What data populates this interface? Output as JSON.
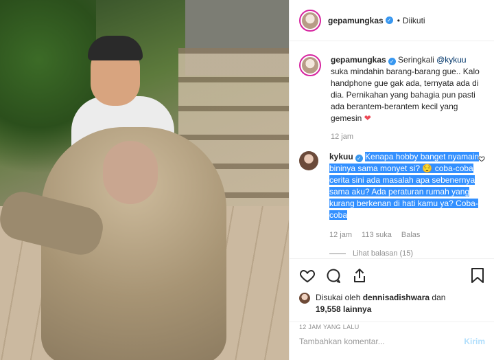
{
  "header": {
    "username": "gepamungkas",
    "separator": "•",
    "follow_status": "Diikuti"
  },
  "caption": {
    "username": "gepamungkas",
    "lead": "Seringkali ",
    "mention": "@kykuu",
    "text": " suka mindahin barang-barang gue.. Kalo handphone gue gak ada, ternyata ada di dia. Pernikahan yang bahagia pun pasti ada berantem-berantem kecil yang gemesin ",
    "heart": "❤",
    "time": "12 jam"
  },
  "reply": {
    "username": "kykuu",
    "text_1": "Kenapa hobby banget nyamain bininya sama monyet si? ",
    "emoji": "😌",
    "text_2": " coba-coba cerita sini ada masalah apa sebenernya sama aku? Ada peraturan rumah yang kurang berkenan di hati kamu ya? Coba-coba",
    "time": "12 jam",
    "likes": "113 suka",
    "reply_label": "Balas",
    "view_replies": "Lihat balasan (15)"
  },
  "likes": {
    "prefix": "Disukai oleh ",
    "user": "dennisadishwara",
    "middle": " dan ",
    "count": "19,558 lainnya"
  },
  "timestamp": "12 JAM YANG LALU",
  "add_comment": {
    "placeholder": "Tambahkan komentar...",
    "post_label": "Kirim"
  },
  "colors": {
    "verified": "#3897f0",
    "selection": "#3390ff",
    "heart": "#ed4956",
    "post_disabled": "#b2dffc"
  },
  "icons": [
    "heart-icon",
    "comment-icon",
    "share-icon",
    "bookmark-icon",
    "verified-icon"
  ]
}
